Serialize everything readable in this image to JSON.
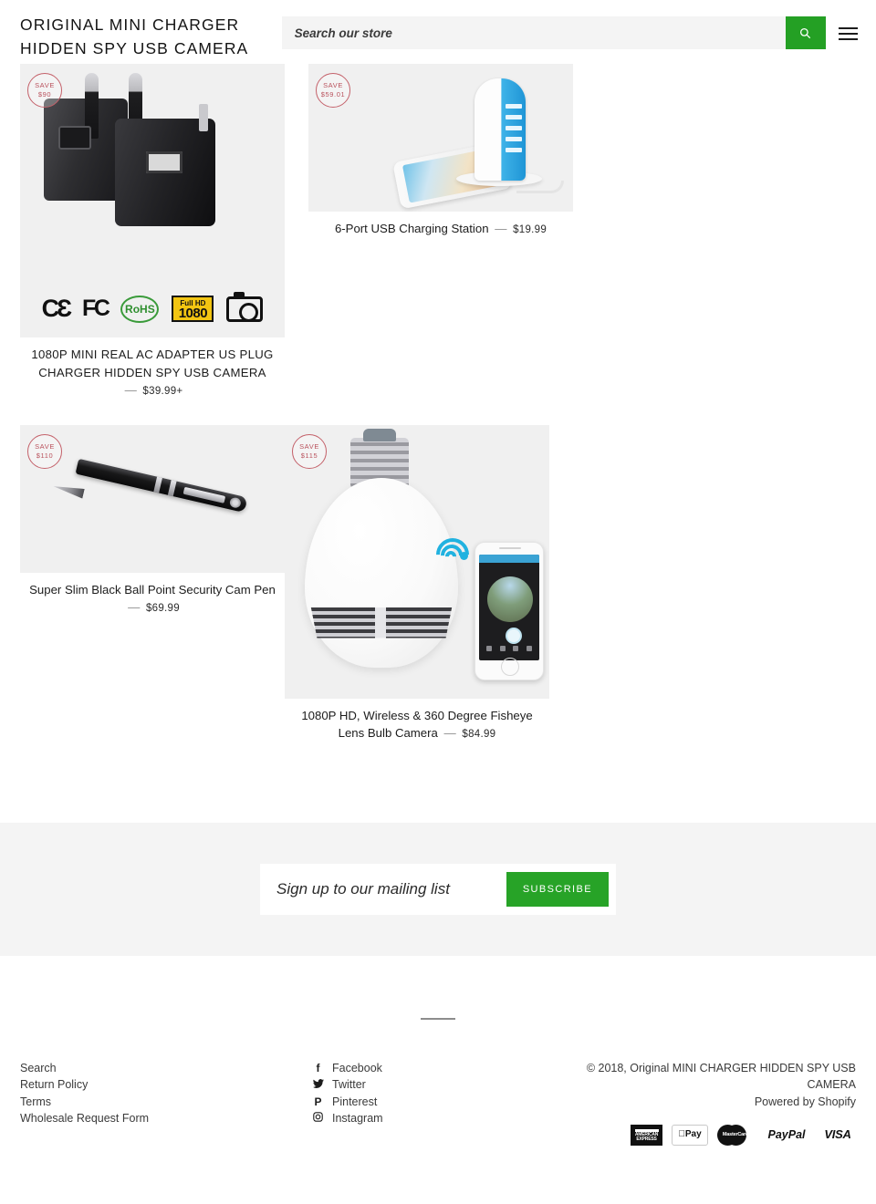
{
  "header": {
    "brand": "ORIGINAL MINI CHARGER HIDDEN SPY USB CAMERA",
    "search_placeholder": "Search our store",
    "search_value": "",
    "search_icon": "search-icon",
    "menu_icon": "hamburger-menu-icon"
  },
  "products": [
    {
      "badge_label": "SAVE",
      "badge_amount": "$90",
      "title": "1080P MINI REAL AC ADAPTER US PLUG CHARGER HIDDEN SPY USB CAMERA",
      "price": "$39.99+",
      "dash": "—",
      "certs": [
        "CE",
        "FC",
        "RoHS",
        "Full HD 1080",
        "camera-icon"
      ]
    },
    {
      "badge_label": "SAVE",
      "badge_amount": "$59.01",
      "title": "6-Port USB Charging Station",
      "price": "$19.99",
      "dash": "—"
    },
    {
      "badge_label": "SAVE",
      "badge_amount": "$110",
      "title": "Super Slim Black Ball Point Security Cam Pen",
      "price": "$69.99",
      "dash": "—"
    },
    {
      "badge_label": "SAVE",
      "badge_amount": "$115",
      "title": "1080P HD, Wireless & 360 Degree Fisheye Lens Bulb Camera",
      "price": "$84.99",
      "dash": "—"
    }
  ],
  "newsletter": {
    "placeholder": "Sign up to our mailing list",
    "value": "",
    "button": "SUBSCRIBE"
  },
  "footer": {
    "links": [
      {
        "label": "Search"
      },
      {
        "label": "Return Policy"
      },
      {
        "label": "Terms"
      },
      {
        "label": "Wholesale Request Form"
      }
    ],
    "social": [
      {
        "label": "Facebook",
        "glyph": "f",
        "icon": "facebook-icon"
      },
      {
        "label": "Twitter",
        "glyph": "✉",
        "icon": "twitter-icon"
      },
      {
        "label": "Pinterest",
        "glyph": "P",
        "icon": "pinterest-icon"
      },
      {
        "label": "Instagram",
        "glyph": "▢",
        "icon": "instagram-icon"
      }
    ],
    "copyright": "© 2018, Original MINI CHARGER HIDDEN SPY USB CAMERA",
    "powered_by": "Powered by Shopify",
    "payments": [
      {
        "name": "american-express",
        "label": "AMERICAN EXPRESS"
      },
      {
        "name": "apple-pay",
        "label": "Pay"
      },
      {
        "name": "mastercard",
        "label": "MasterCard"
      },
      {
        "name": "paypal",
        "label": "PayPal"
      },
      {
        "name": "visa",
        "label": "VISA"
      }
    ]
  },
  "colors": {
    "accent_green": "#24a024",
    "badge_red": "#b9515c",
    "thumb_bg": "#f0f0f0",
    "newsletter_bg": "#f4f4f4"
  }
}
